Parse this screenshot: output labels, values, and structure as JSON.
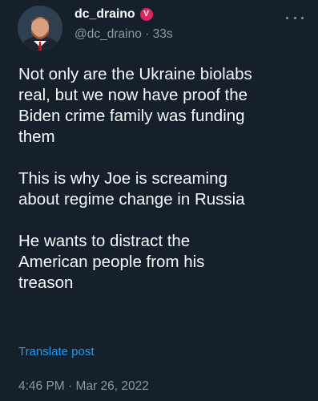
{
  "author": {
    "display_name": "dc_draino",
    "verified_badge_glyph": "V",
    "handle": "@dc_draino",
    "separator": "·",
    "time_ago": "33s",
    "avatar_icon": "profile-photo",
    "badge_color": "#e0245e"
  },
  "tweet": {
    "line1": "Not only are the Ukraine biolabs",
    "line2": "real, but we now have proof the",
    "line3": "Biden crime family was funding",
    "line4": "them",
    "line5": "This is why Joe is screaming",
    "line6": "about regime change in Russia",
    "line7": "He wants to distract the",
    "line8": "American people from his",
    "line9": "treason"
  },
  "actions": {
    "translate": "Translate post",
    "more_icon": "more-options-icon"
  },
  "meta": {
    "time": "4:46 PM",
    "separator": "·",
    "date": "Mar 26, 2022"
  },
  "colors": {
    "background": "#15202b",
    "text": "#f7f9f9",
    "secondary": "#8b98a5",
    "link": "#1d9bf0"
  }
}
